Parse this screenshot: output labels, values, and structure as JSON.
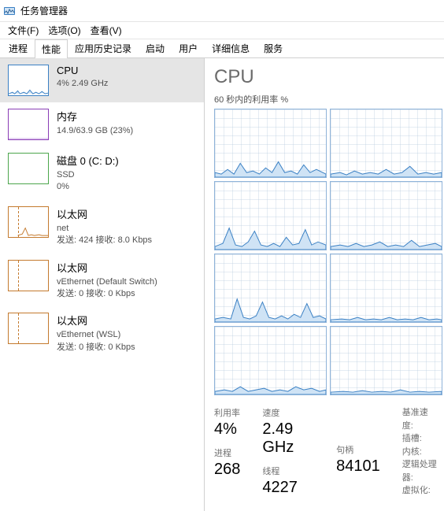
{
  "window": {
    "title": "任务管理器"
  },
  "menu": {
    "file": "文件(F)",
    "options": "选项(O)",
    "view": "查看(V)"
  },
  "tabs": {
    "processes": "进程",
    "performance": "性能",
    "apphistory": "应用历史记录",
    "startup": "启动",
    "users": "用户",
    "details": "详细信息",
    "services": "服务"
  },
  "sidebar": [
    {
      "title": "CPU",
      "sub1": "4% 2.49 GHz",
      "color": "#3a80c4"
    },
    {
      "title": "内存",
      "sub1": "14.9/63.9 GB (23%)",
      "color": "#8a3db6"
    },
    {
      "title": "磁盘 0 (C: D:)",
      "sub1": "SSD",
      "sub2": "0%",
      "color": "#4ca64c"
    },
    {
      "title": "以太网",
      "sub1": "net",
      "sub2": "发送: 424 接收: 8.0 Kbps",
      "color": "#c47a2e"
    },
    {
      "title": "以太网",
      "sub1": "vEthernet (Default Switch)",
      "sub2": "发送: 0 接收: 0 Kbps",
      "color": "#c47a2e"
    },
    {
      "title": "以太网",
      "sub1": "vEthernet (WSL)",
      "sub2": "发送: 0 接收: 0 Kbps",
      "color": "#c47a2e"
    }
  ],
  "detail": {
    "heading": "CPU",
    "chart_caption": "60 秒内的利用率 %",
    "stats": {
      "util_label": "利用率",
      "util_value": "4%",
      "speed_label": "速度",
      "speed_value": "2.49 GHz",
      "base_label": "基准速度:",
      "sockets_label": "插槽:",
      "cores_label": "内核:",
      "logical_label": "逻辑处理器:",
      "virt_label": "虚拟化:",
      "proc_label": "进程",
      "proc_value": "268",
      "thread_label": "线程",
      "thread_value": "4227",
      "handle_label": "句柄",
      "handle_value": "84101"
    }
  },
  "chart_data": {
    "type": "line",
    "title": "CPU 60 秒内的利用率 %",
    "ylabel": "利用率 %",
    "ylim": [
      0,
      100
    ],
    "x_seconds": 60,
    "series_count": 8,
    "note": "8 logical processor mini-charts, each low utilization ~3-20% with occasional spikes",
    "sample_values": [
      5,
      8,
      4,
      12,
      6,
      3,
      15,
      7,
      4,
      9,
      20,
      5,
      6,
      30,
      4,
      8,
      10,
      5,
      3,
      18,
      6,
      4,
      25,
      7,
      5,
      10,
      8,
      28,
      5,
      4
    ]
  }
}
